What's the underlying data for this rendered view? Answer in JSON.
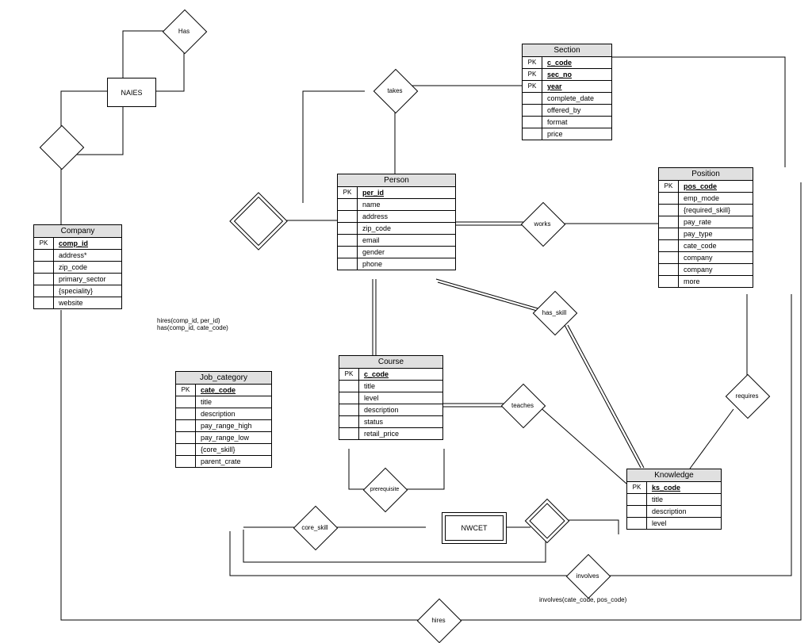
{
  "entities": {
    "company": {
      "title": "Company",
      "pk": "comp_id",
      "attrs": [
        "address*",
        "zip_code",
        "primary_sector",
        "{speciality}",
        "website"
      ]
    },
    "person": {
      "title": "Person",
      "pk": "per_id",
      "attrs": [
        "name",
        "address",
        "zip_code",
        "email",
        "gender",
        "phone"
      ]
    },
    "section": {
      "title": "Section",
      "pks": [
        "c_code",
        "sec_no",
        "year"
      ],
      "attrs": [
        "complete_date",
        "offered_by",
        "format",
        "price"
      ]
    },
    "position": {
      "title": "Position",
      "pk": "pos_code",
      "attrs": [
        "emp_mode",
        "{required_skill}",
        "pay_rate",
        "pay_type",
        "cate_code",
        "company",
        "company",
        "more"
      ]
    },
    "course": {
      "title": "Course",
      "pk": "c_code",
      "attrs": [
        "title",
        "level",
        "description",
        "status",
        "retail_price"
      ]
    },
    "job_category": {
      "title": "Job_category",
      "pk": "cate_code",
      "attrs": [
        "title",
        "description",
        "pay_range_high",
        "pay_range_low",
        "{core_skill}",
        "parent_crate"
      ]
    },
    "knowledge": {
      "title": "Knowledge",
      "pk": "ks_code",
      "attrs": [
        "title",
        "description",
        "level"
      ]
    }
  },
  "boxes": {
    "naies": "NAIES",
    "nwcet": "NWCET"
  },
  "relations": {
    "has": "Has",
    "takes": "takes",
    "works": "works",
    "has_skill": "has_skill",
    "requires": "requires",
    "teaches": "teaches",
    "prerequisite": "prerequisite",
    "core_skill": "core_skill",
    "involves": "involves",
    "hires": "hires"
  },
  "pk_label": "PK",
  "annotations": {
    "hires_has": "hires(comp_id, per_id)\nhas(comp_id, cate_code)",
    "involves": "involves(cate_code, pos_code)"
  }
}
